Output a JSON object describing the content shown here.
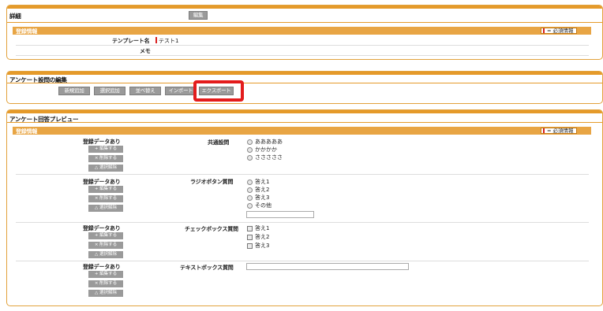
{
  "detail": {
    "title": "詳細",
    "edit_button": "編集",
    "section_label": "登録情報",
    "required_legend": "= 必須情報",
    "template_name_label": "テンプレート名",
    "template_name_value": "テスト1",
    "memo_label": "メモ"
  },
  "question_edit": {
    "title": "アンケート設問の編集",
    "buttons": [
      "新規追加",
      "選択追加",
      "並べ替え",
      "インポート",
      "エクスポート"
    ]
  },
  "preview": {
    "title": "アンケート回答プレビュー",
    "section_label": "登録情報",
    "required_legend": "= 必須情報",
    "registered_label": "登録データあり",
    "row_buttons": [
      "+ 編集する",
      "× 削除する",
      "△ 選択解除"
    ],
    "questions": [
      {
        "title": "共通設問",
        "type": "radio",
        "options": [
          "あああああ",
          "かかかか",
          "さささささ"
        ]
      },
      {
        "title": "ラジオボタン質問",
        "type": "radio",
        "options": [
          "答え1",
          "答え2",
          "答え3",
          "その他"
        ]
      },
      {
        "title": "チェックボックス質問",
        "type": "checkbox",
        "options": [
          "答え1",
          "答え2",
          "答え3"
        ]
      },
      {
        "title": "テキストボックス質問",
        "type": "text",
        "options": []
      }
    ]
  },
  "colors": {
    "accent": "#e59a2a",
    "section": "#e8a544",
    "highlight": "#e31c1c",
    "button": "#9a9a9a"
  }
}
